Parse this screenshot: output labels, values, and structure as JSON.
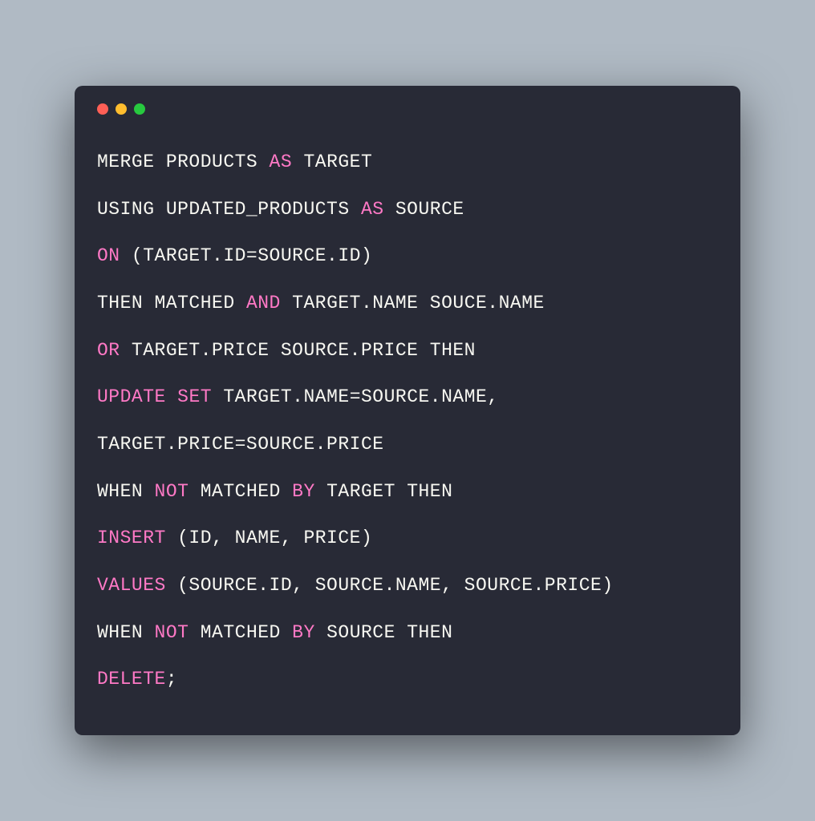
{
  "colors": {
    "background": "#b0bac4",
    "window_bg": "#282a36",
    "text": "#f8f8f2",
    "keyword": "#ff79c6",
    "red_light": "#ff5f56",
    "yellow_light": "#ffbd2e",
    "green_light": "#27c93f"
  },
  "code_lines": [
    {
      "tokens": [
        {
          "t": "MERGE PRODUCTS ",
          "kw": false
        },
        {
          "t": "AS",
          "kw": true
        },
        {
          "t": " TARGET",
          "kw": false
        }
      ]
    },
    {
      "tokens": [
        {
          "t": "USING UPDATED_PRODUCTS ",
          "kw": false
        },
        {
          "t": "AS",
          "kw": true
        },
        {
          "t": " SOURCE",
          "kw": false
        }
      ]
    },
    {
      "tokens": [
        {
          "t": "ON",
          "kw": true
        },
        {
          "t": " (TARGET.ID=SOURCE.ID)",
          "kw": false
        }
      ]
    },
    {
      "tokens": [
        {
          "t": "THEN MATCHED ",
          "kw": false
        },
        {
          "t": "AND",
          "kw": true
        },
        {
          "t": " TARGET.NAME SOUCE.NAME",
          "kw": false
        }
      ]
    },
    {
      "tokens": [
        {
          "t": "OR",
          "kw": true
        },
        {
          "t": " TARGET.PRICE SOURCE.PRICE THEN",
          "kw": false
        }
      ]
    },
    {
      "tokens": [
        {
          "t": "UPDATE",
          "kw": true
        },
        {
          "t": " ",
          "kw": false
        },
        {
          "t": "SET",
          "kw": true
        },
        {
          "t": " TARGET.NAME=SOURCE.NAME,",
          "kw": false
        }
      ]
    },
    {
      "tokens": [
        {
          "t": "TARGET.PRICE=SOURCE.PRICE",
          "kw": false
        }
      ]
    },
    {
      "tokens": [
        {
          "t": "WHEN ",
          "kw": false
        },
        {
          "t": "NOT",
          "kw": true
        },
        {
          "t": " MATCHED ",
          "kw": false
        },
        {
          "t": "BY",
          "kw": true
        },
        {
          "t": " TARGET THEN",
          "kw": false
        }
      ]
    },
    {
      "tokens": [
        {
          "t": "INSERT",
          "kw": true
        },
        {
          "t": " (ID, NAME, PRICE)",
          "kw": false
        }
      ]
    },
    {
      "tokens": [
        {
          "t": "VALUES",
          "kw": true
        },
        {
          "t": " (SOURCE.ID, SOURCE.NAME, SOURCE.PRICE)",
          "kw": false
        }
      ]
    },
    {
      "tokens": [
        {
          "t": "WHEN ",
          "kw": false
        },
        {
          "t": "NOT",
          "kw": true
        },
        {
          "t": " MATCHED ",
          "kw": false
        },
        {
          "t": "BY",
          "kw": true
        },
        {
          "t": " SOURCE THEN",
          "kw": false
        }
      ]
    },
    {
      "tokens": [
        {
          "t": "DELETE",
          "kw": true
        },
        {
          "t": ";",
          "kw": false
        }
      ]
    }
  ]
}
